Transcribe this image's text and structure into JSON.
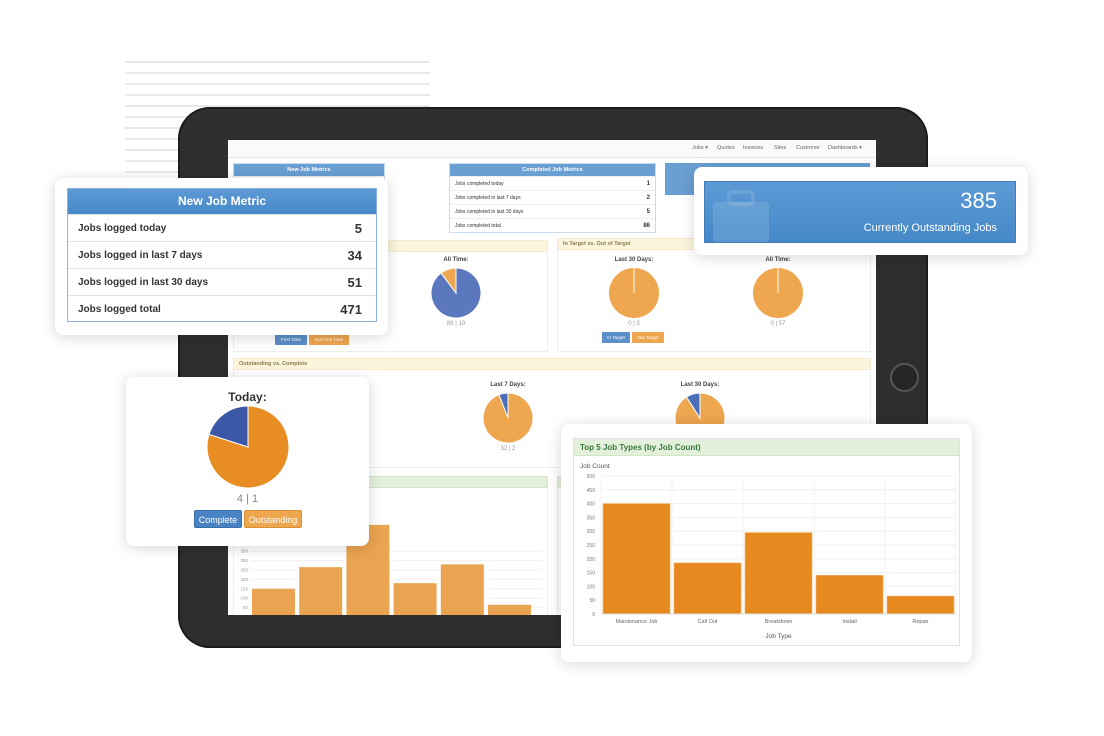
{
  "tablet": {
    "nav": [
      "Jobs ▾",
      "Quotes",
      "Invoices",
      "Sites",
      "Customer",
      "Dashboards ▾"
    ],
    "new_job_metrics": {
      "title": "New Job Metrics",
      "values": [
        "5",
        "34",
        "51",
        "471"
      ]
    },
    "completed_job_metrics": {
      "title": "Completed Job Metrics",
      "rows": [
        {
          "label": "Jobs completed today",
          "value": "1"
        },
        {
          "label": "Jobs completed in last 7 days",
          "value": "2"
        },
        {
          "label": "Jobs completed in last 30 days",
          "value": "5"
        },
        {
          "label": "Jobs completed total",
          "value": "86"
        }
      ]
    },
    "first_time": {
      "all_time_label": "All Time:",
      "counts": "88 | 10",
      "btn_first": "First Time",
      "btn_not_first": "Not First Time",
      "slices": [
        88,
        10
      ]
    },
    "in_target": {
      "title": "In Target vs. Out of Target",
      "last30_label": "Last 30 Days:",
      "last30_counts": "0 | 3",
      "alltime_label": "All Time:",
      "alltime_counts": "0 | 57",
      "btn_in": "In Target",
      "btn_out": "Out Target",
      "last30_slices": [
        0,
        3
      ],
      "alltime_slices": [
        0,
        57
      ]
    },
    "outstanding_vs_complete": {
      "title": "Outstanding vs. Complete",
      "last7_label": "Last 7 Days:",
      "last7_counts": "32 | 2",
      "last7_slices": [
        32,
        2
      ],
      "last30_label": "Last 30 Days:",
      "last30_slices": [
        30,
        3
      ]
    },
    "bar_chart": {
      "y_ticks": [
        "50",
        "100",
        "150",
        "200",
        "250",
        "300",
        "350"
      ],
      "values": [
        150,
        265,
        490,
        180,
        280,
        65
      ]
    }
  },
  "new_job_metric_card": {
    "title": "New Job Metric",
    "rows": [
      {
        "label": "Jobs logged today",
        "value": "5"
      },
      {
        "label": "Jobs logged in last 7 days",
        "value": "34"
      },
      {
        "label": "Jobs logged in last 30 days",
        "value": "51"
      },
      {
        "label": "Jobs logged total",
        "value": "471"
      }
    ]
  },
  "outstanding_card": {
    "value": "385",
    "label": "Currently Outstanding Jobs",
    "icon": "briefcase-icon"
  },
  "today_card": {
    "title": "Today:",
    "counts": "4 | 1",
    "complete": 4,
    "outstanding": 1,
    "btn_complete": "Complete",
    "btn_outstanding": "Outstanding"
  },
  "colors": {
    "blue": "#4a83c4",
    "orange": "#e88d24",
    "pie_blue": "#3e5ea8",
    "green_header": "#e3f1dc"
  },
  "chart_data": {
    "type": "bar",
    "title": "Top 5 Job Types (by Job Count)",
    "xlabel": "Job Type",
    "ylabel": "Job Count",
    "categories": [
      "Maintenance Job",
      "Call Out",
      "Breakdown",
      "Install",
      "Repair"
    ],
    "values": [
      400,
      185,
      295,
      140,
      65
    ],
    "ylim": [
      0,
      500
    ],
    "y_ticks": [
      "0",
      "50",
      "100",
      "150",
      "200",
      "250",
      "300",
      "350",
      "400",
      "450",
      "500"
    ],
    "grid": true
  }
}
